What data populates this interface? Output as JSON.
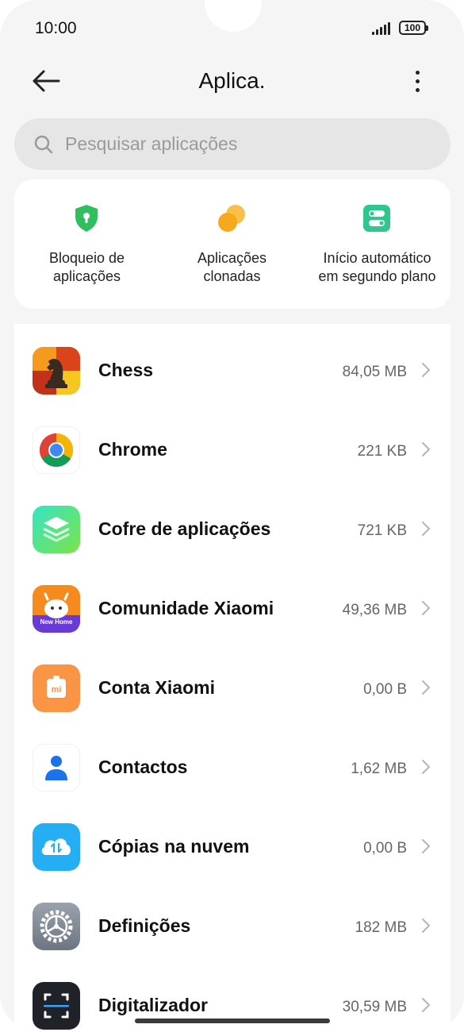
{
  "status": {
    "time": "10:00",
    "battery": "100"
  },
  "header": {
    "title": "Aplica."
  },
  "search": {
    "placeholder": "Pesquisar aplicações"
  },
  "shortcuts": [
    {
      "label": "Bloqueio de\naplicações",
      "icon": "shield-lock-icon",
      "color": "#2fbf5f"
    },
    {
      "label": "Aplicações\nclonadas",
      "icon": "clone-icon",
      "color": "#f7a91e"
    },
    {
      "label": "Início automático\nem segundo plano",
      "icon": "toggle-icon",
      "color": "#2fc78f"
    }
  ],
  "apps": [
    {
      "name": "Chess",
      "size": "84,05 MB",
      "icon": "chess-icon"
    },
    {
      "name": "Chrome",
      "size": "221 KB",
      "icon": "chrome-icon"
    },
    {
      "name": "Cofre de aplicações",
      "size": "721 KB",
      "icon": "app-vault-icon"
    },
    {
      "name": "Comunidade Xiaomi",
      "size": "49,36 MB",
      "icon": "xiaomi-community-icon",
      "badge": "New Home"
    },
    {
      "name": "Conta Xiaomi",
      "size": "0,00 B",
      "icon": "xiaomi-account-icon"
    },
    {
      "name": "Contactos",
      "size": "1,62 MB",
      "icon": "contacts-icon"
    },
    {
      "name": "Cópias na nuvem",
      "size": "0,00 B",
      "icon": "cloud-backup-icon"
    },
    {
      "name": "Definições",
      "size": "182 MB",
      "icon": "settings-gear-icon"
    },
    {
      "name": "Digitalizador",
      "size": "30,59 MB",
      "icon": "scanner-icon"
    }
  ]
}
